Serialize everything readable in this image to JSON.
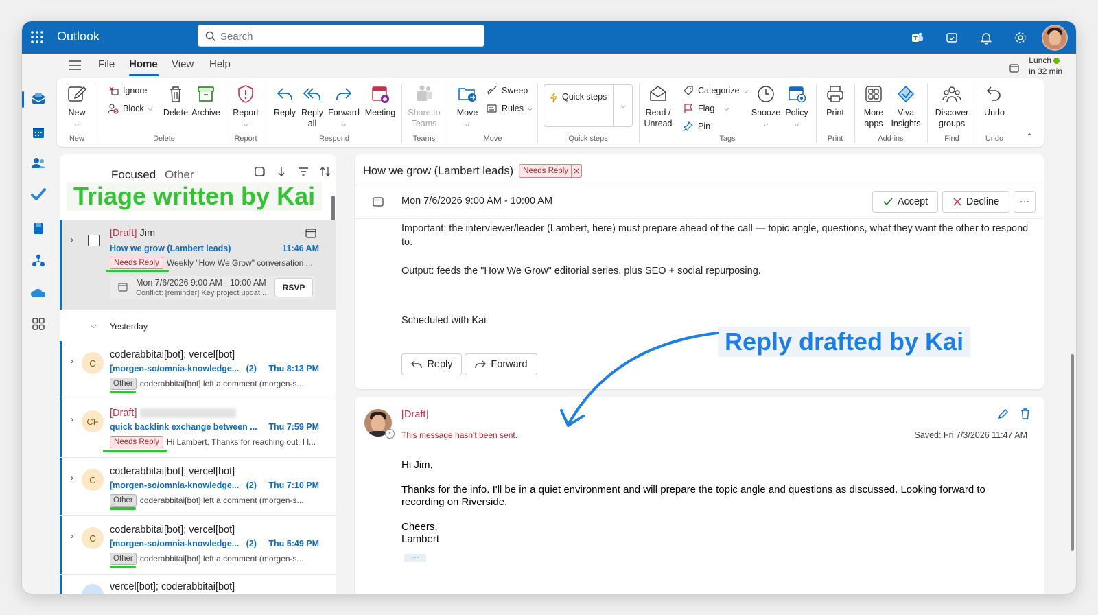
{
  "app": {
    "name": "Outlook"
  },
  "search": {
    "placeholder": "Search"
  },
  "menu": {
    "file": "File",
    "home": "Home",
    "view": "View",
    "help": "Help"
  },
  "lunch": {
    "line1": "Lunch",
    "line2": "in 32 min"
  },
  "ribbon": {
    "new": "New",
    "ignore": "Ignore",
    "block": "Block",
    "delete": "Delete",
    "archive": "Archive",
    "report": "Report",
    "reply": "Reply",
    "reply_all_1": "Reply",
    "reply_all_2": "all",
    "forward": "Forward",
    "meeting": "Meeting",
    "share_teams_1": "Share to",
    "share_teams_2": "Teams",
    "move": "Move",
    "sweep": "Sweep",
    "rules": "Rules",
    "quick_steps": "Quick steps",
    "read_unread_1": "Read /",
    "read_unread_2": "Unread",
    "categorize": "Categorize",
    "flag": "Flag",
    "pin": "Pin",
    "snooze": "Snooze",
    "policy": "Policy",
    "print": "Print",
    "more_apps_1": "More",
    "more_apps_2": "apps",
    "viva_1": "Viva",
    "viva_2": "Insights",
    "discover_1": "Discover",
    "discover_2": "groups",
    "undo": "Undo",
    "groups": {
      "new": "New",
      "delete": "Delete",
      "report": "Report",
      "respond": "Respond",
      "teams": "Teams",
      "move": "Move",
      "quick_steps": "Quick steps",
      "tags": "Tags",
      "print": "Print",
      "addins": "Add-ins",
      "find": "Find",
      "undo": "Undo"
    }
  },
  "list": {
    "tab_focused": "Focused",
    "tab_other": "Other",
    "annotation": "Triage written by Kai",
    "yesterday": "Yesterday",
    "rows": [
      {
        "draft_prefix": "[Draft]",
        "from": "Jim",
        "subject": "How we grow (Lambert leads)",
        "time": "11:46 AM",
        "badge": "Needs Reply",
        "preview": "Weekly \"How We Grow\" conversation ...",
        "meeting_time": "Mon 7/6/2026 9:00 AM - 10:00 AM",
        "conflict": "Conflict: [reminder] Key project updat...",
        "rsvp": "RSVP"
      },
      {
        "avatar": "C",
        "from": "coderabbitai[bot]; vercel[bot]",
        "subject": "[morgen-so/omnia-knowledge...",
        "count": "(2)",
        "time": "Thu 8:13 PM",
        "badge": "Other",
        "preview": "coderabbitai[bot] left a comment (morgen-s..."
      },
      {
        "avatar": "CF",
        "draft_prefix": "[Draft]",
        "subject": "quick backlink exchange between ...",
        "time": "Thu 7:59 PM",
        "badge": "Needs Reply",
        "preview": "Hi Lambert, Thanks for reaching out, I l..."
      },
      {
        "avatar": "C",
        "from": "coderabbitai[bot]; vercel[bot]",
        "subject": "[morgen-so/omnia-knowledge...",
        "count": "(2)",
        "time": "Thu 7:10 PM",
        "badge": "Other",
        "preview": "coderabbitai[bot] left a comment (morgen-s..."
      },
      {
        "avatar": "C",
        "from": "coderabbitai[bot]; vercel[bot]",
        "subject": "[morgen-so/omnia-knowledge...",
        "count": "(2)",
        "time": "Thu 5:49 PM",
        "badge": "Other",
        "preview": "coderabbitai[bot] left a comment (morgen-s..."
      },
      {
        "from": "vercel[bot]; coderabbitai[bot]"
      }
    ]
  },
  "reading": {
    "title": "How we grow (Lambert leads)",
    "badge": "Needs Reply",
    "meeting_time": "Mon 7/6/2026 9:00 AM - 10:00 AM",
    "accept": "Accept",
    "decline": "Decline",
    "more": "···",
    "p1": "Important: the interviewer/leader (Lambert, here) must prepare ahead of the call — topic angle, questions, what they want the other to respond to.",
    "p2": "Output: feeds the \"How We Grow\" editorial series, plus SEO + social repurposing.",
    "p3": "Scheduled with Kai",
    "reply_btn": "Reply",
    "forward_btn": "Forward",
    "annotation": "Reply drafted by Kai"
  },
  "draft": {
    "label": "[Draft]",
    "unsent": "This message hasn't been sent.",
    "saved": "Saved: Fri 7/3/2026 11:47 AM",
    "greeting": "Hi Jim,",
    "body": "Thanks for the info. I'll be in a quiet environment and will prepare the topic angle and questions as discussed. Looking forward to recording on Riverside.",
    "closing": "Cheers,",
    "name": "Lambert",
    "more": "···"
  },
  "colors": {
    "brand": "#0f6cbd",
    "annotation_green": "#36c236",
    "annotation_blue": "#1f7fe0",
    "needs_reply": "#a4262c"
  }
}
